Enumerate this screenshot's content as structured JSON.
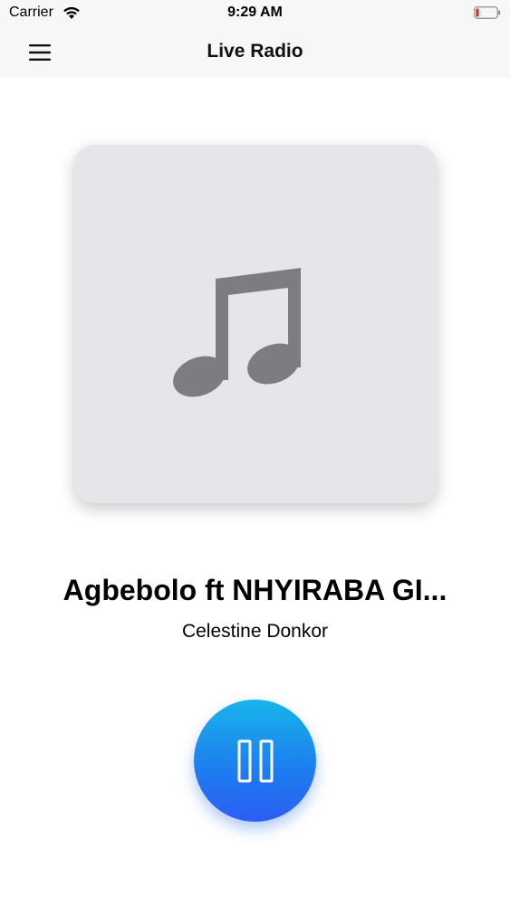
{
  "status_bar": {
    "carrier": "Carrier",
    "time": "9:29 AM",
    "wifi_icon": "wifi-icon",
    "battery_icon": "battery-icon"
  },
  "nav": {
    "title": "Live Radio",
    "menu_icon": "hamburger-menu-icon"
  },
  "player": {
    "artwork_icon": "music-note-icon",
    "track_title": "Agbebolo ft NHYIRABA GI...",
    "artist": "Celestine Donkor",
    "state": "playing",
    "control_icon": "pause-icon"
  },
  "colors": {
    "artwork_bg": "#e6e5ea",
    "icon_gray": "#7d7c81",
    "button_top": "#18b4ea",
    "button_bottom": "#2c5ff2",
    "bar_bg": "#f7f7f7"
  }
}
